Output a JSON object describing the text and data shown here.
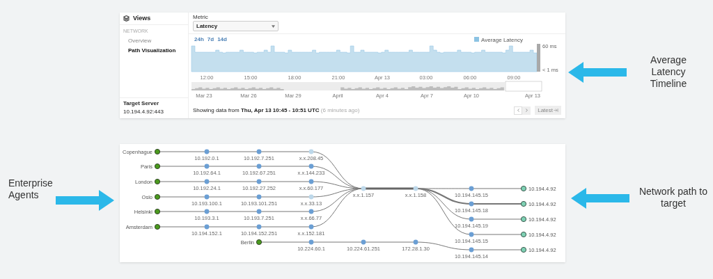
{
  "callouts": [
    "Average Latency Timeline",
    "Enterprise Agents",
    "Network path to target"
  ],
  "views": {
    "title": "Views",
    "section": "NETWORK",
    "items": [
      {
        "label": "Overview",
        "selected": false
      },
      {
        "label": "Path Visualization",
        "selected": true
      }
    ],
    "target_server": {
      "label": "Target Server",
      "value": "10.194.4.92:443"
    },
    "metric": {
      "label": "Metric",
      "value": "Latency"
    },
    "ranges": [
      "24h",
      "7d",
      "14d"
    ],
    "legend": "Average Latency",
    "y_labels": [
      "60 ms",
      "< 1 ms"
    ],
    "x_labels": [
      "12:00",
      "15:00",
      "18:00",
      "21:00",
      "Apr 13",
      "03:00",
      "06:00",
      "09:00"
    ],
    "overview_labels": [
      "Mar 23",
      "Mar 26",
      "Mar 29",
      "April",
      "Apr 4",
      "Apr 7",
      "Apr 10",
      "Apr 13"
    ],
    "status": {
      "text": "Showing data from **Thu, Apr 13 10:45 - 10:51 UTC**",
      "ago": "(6 minutes ago)"
    },
    "latest_button": "Latest"
  },
  "path": {
    "agents": [
      {
        "name": "Copenhague",
        "hops": [
          {
            "ip": "10.192.0.1",
            "color": "#6b9fd4"
          },
          {
            "ip": "10.192.7.251",
            "color": "#6b9fd4"
          },
          {
            "ip": "x.x.208.45",
            "color": "#bdd8ea"
          }
        ]
      },
      {
        "name": "Paris",
        "hops": [
          {
            "ip": "10.192.64.1",
            "color": "#6b9fd4"
          },
          {
            "ip": "10.192.67.251",
            "color": "#6b9fd4"
          },
          {
            "ip": "x.x.144.233",
            "color": "#6b9fd4"
          }
        ]
      },
      {
        "name": "London",
        "hops": [
          {
            "ip": "10.192.24.1",
            "color": "#6b9fd4"
          },
          {
            "ip": "10.192.27.252",
            "color": "#6b9fd4"
          },
          {
            "ip": "x.x.60.177",
            "color": "#6b9fd4"
          }
        ]
      },
      {
        "name": "Oslo",
        "hops": [
          {
            "ip": "10.193.100.1",
            "color": "#6b9fd4"
          },
          {
            "ip": "10.193.101.251",
            "color": "#6b9fd4"
          },
          {
            "ip": "x.x.33.13",
            "color": "#bdd8ea"
          }
        ]
      },
      {
        "name": "Helsinki",
        "hops": [
          {
            "ip": "10.193.3.1",
            "color": "#6b9fd4"
          },
          {
            "ip": "10.193.7.251",
            "color": "#6b9fd4"
          },
          {
            "ip": "x.x.66.77",
            "color": "#6b9fd4"
          }
        ]
      },
      {
        "name": "Amsterdam",
        "hops": [
          {
            "ip": "10.194.152.1",
            "color": "#6b9fd4"
          },
          {
            "ip": "10.194.152.251",
            "color": "#6b9fd4"
          },
          {
            "ip": "x.x.152.181",
            "color": "#6b9fd4"
          }
        ]
      },
      {
        "name": "Berlin",
        "hops": [
          {
            "ip": "10.224.60.1",
            "color": "#6b9fd4"
          },
          {
            "ip": "10.224.61.251",
            "color": "#6b9fd4"
          },
          {
            "ip": "172.28.1.30",
            "color": "#6b9fd4"
          }
        ]
      }
    ],
    "shared_hops": [
      {
        "ip": "x.x.1.157",
        "color": "#bdd8ea"
      },
      {
        "ip": "x.x.1.158",
        "color": "#bdd8ea"
      }
    ],
    "egress": [
      {
        "ip": "10.194.145.15",
        "target": "10.194.4.92"
      },
      {
        "ip": "10.194.145.18",
        "target": "10.194.4.92"
      },
      {
        "ip": "10.194.145.19",
        "target": "10.194.4.92"
      },
      {
        "ip": "10.194.145.15",
        "target": "10.194.4.92"
      },
      {
        "ip": "10.194.145.14",
        "target": "10.194.4.92"
      }
    ]
  }
}
